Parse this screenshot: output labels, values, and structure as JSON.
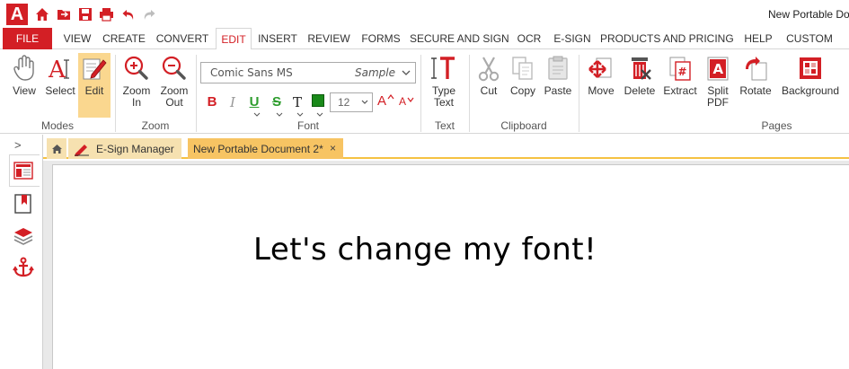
{
  "titlebar": {
    "app_logo": "A",
    "window_title": "New Portable Docu",
    "quick_access_icons": [
      "home-icon",
      "folder-icon",
      "save-icon",
      "print-icon",
      "undo-icon",
      "redo-icon"
    ]
  },
  "menu": {
    "file": "FILE",
    "items": [
      "VIEW",
      "CREATE",
      "CONVERT",
      "EDIT",
      "INSERT",
      "REVIEW",
      "FORMS",
      "SECURE AND SIGN",
      "OCR",
      "E-SIGN",
      "PRODUCTS AND PRICING",
      "HELP",
      "CUSTOM"
    ],
    "active": "EDIT"
  },
  "ribbon": {
    "modes": {
      "label": "Modes",
      "view": "View",
      "select": "Select",
      "edit": "Edit"
    },
    "zoom": {
      "label": "Zoom",
      "zoom_in": "Zoom\nIn",
      "zoom_out": "Zoom\nOut"
    },
    "font": {
      "label": "Font",
      "font_name": "Comic Sans MS",
      "sample": "Sample",
      "size": "12",
      "bold": "B",
      "italic": "I",
      "underline": "U",
      "strike": "S",
      "text_color_glyph": "T",
      "grow": "A",
      "shrink": "A"
    },
    "text": {
      "label": "Text",
      "type_text": "Type\nText"
    },
    "clipboard": {
      "label": "Clipboard",
      "cut": "Cut",
      "copy": "Copy",
      "paste": "Paste"
    },
    "pages": {
      "label": "Pages",
      "move": "Move",
      "delete": "Delete",
      "extract": "Extract",
      "split": "Split\nPDF",
      "rotate": "Rotate",
      "background": "Background"
    }
  },
  "sidebar": {
    "expand_glyph": ">",
    "icons": [
      "page-thumbnails-icon",
      "bookmarks-icon",
      "layers-icon",
      "anchor-icon"
    ]
  },
  "tabs": {
    "esign": "E-Sign Manager",
    "document": "New Portable Document 2*",
    "close_glyph": "×"
  },
  "document": {
    "text": "Let's change my font!"
  },
  "colors": {
    "brand_red": "#d31f25",
    "active_tab": "#f7c463",
    "inactive_tab": "#f6e1b0",
    "active_button": "#fad78f"
  }
}
